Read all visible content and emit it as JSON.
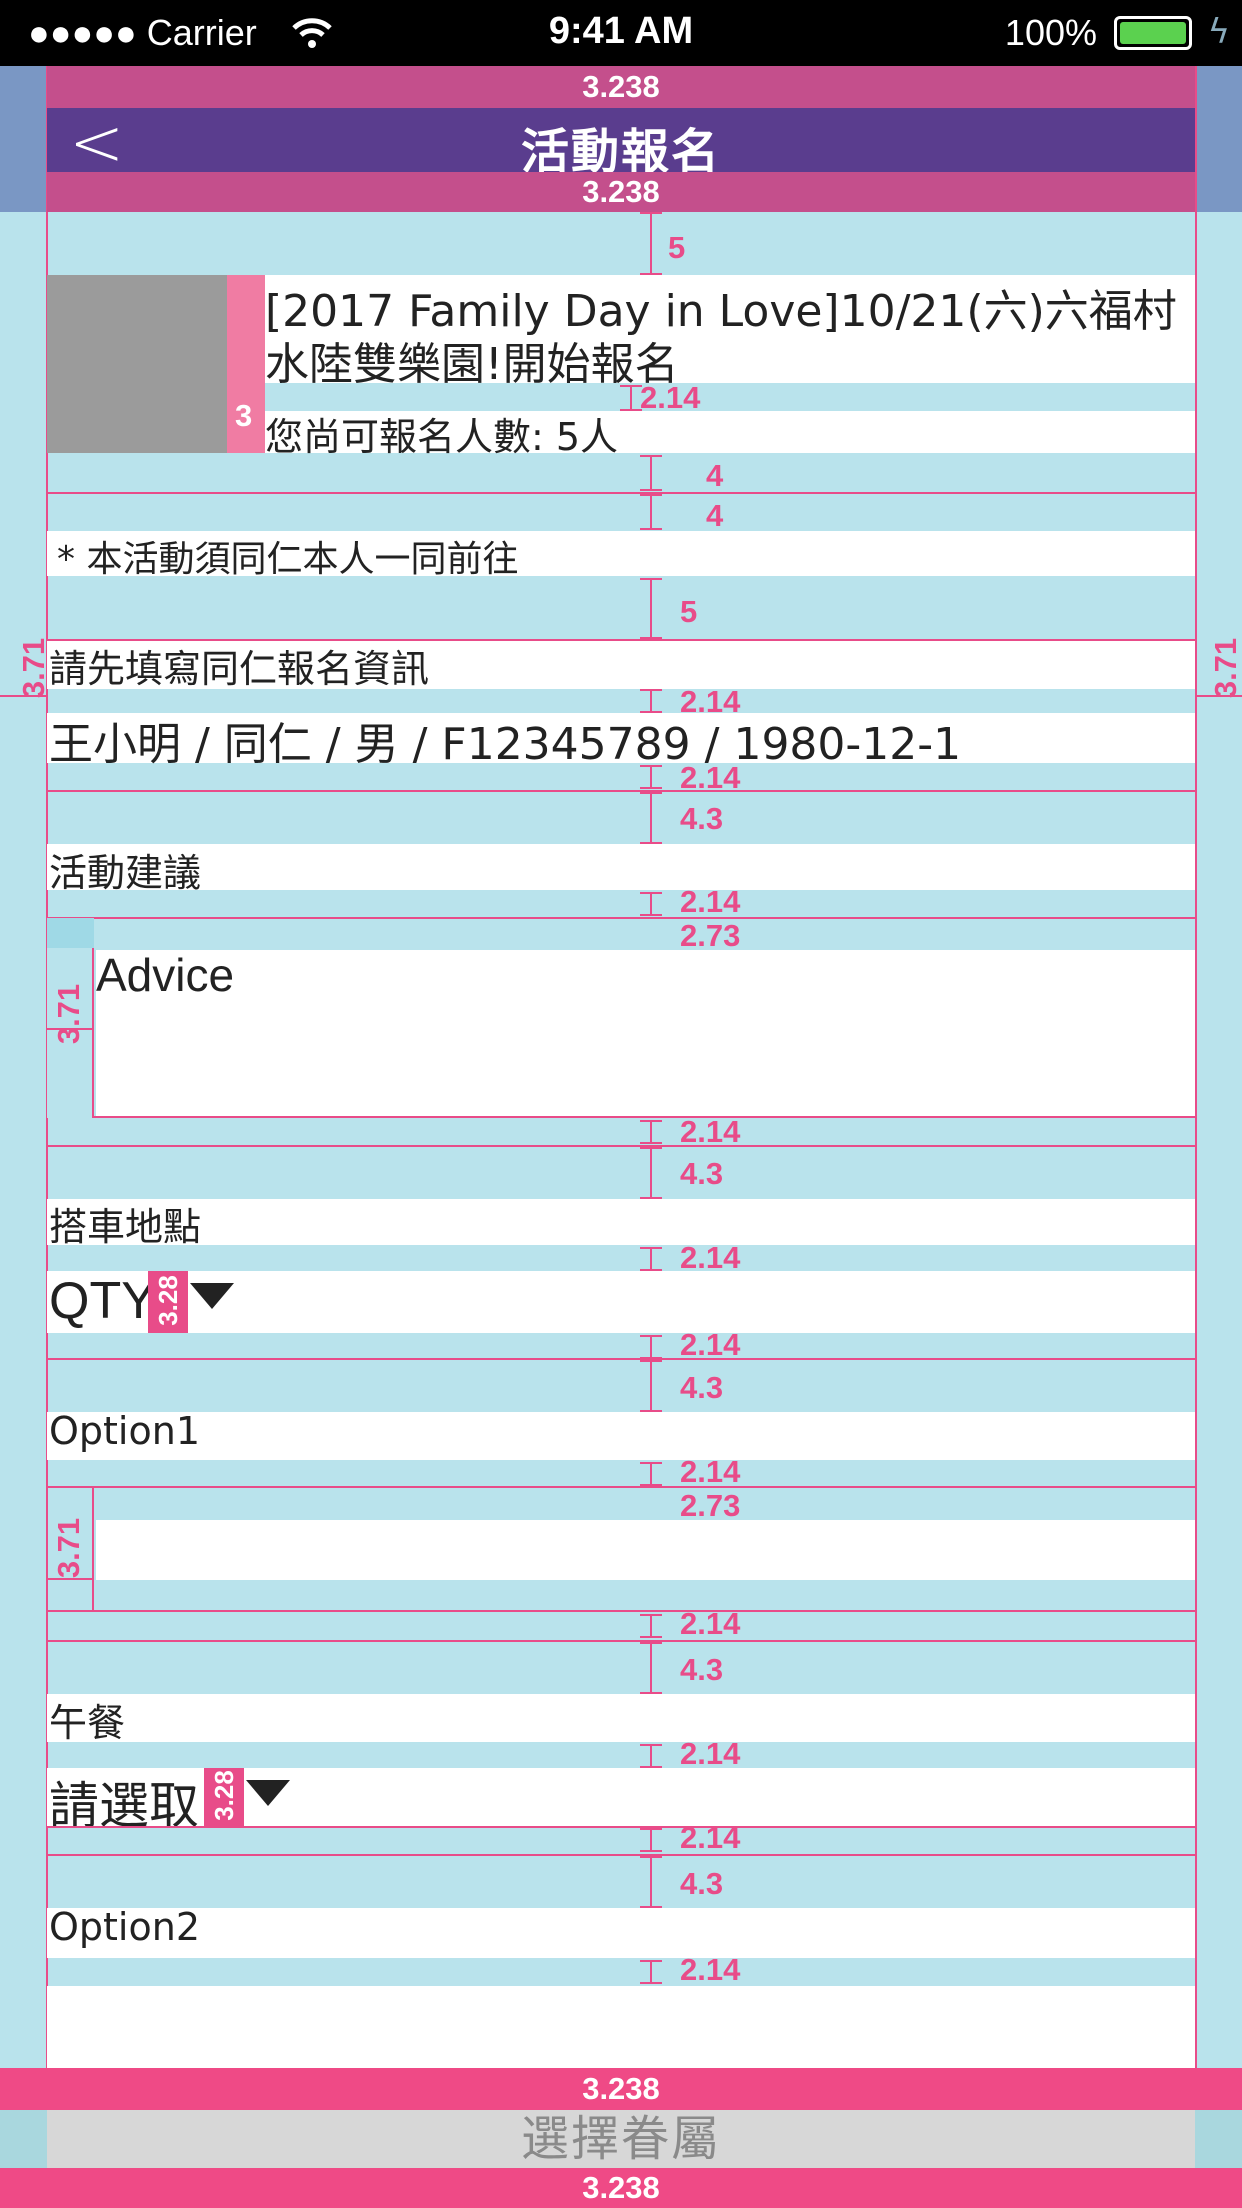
{
  "status_bar": {
    "carrier": "●●●●● Carrier",
    "time": "9:41 AM",
    "battery_pct": "100%"
  },
  "nav": {
    "title": "活動報名",
    "back_icon": "chevron-left-icon"
  },
  "event": {
    "title_line1": "[2017 Family Day in Love]10/21(六)六福村",
    "title_line2": "水陸雙樂園!開始報名",
    "remaining": "您尚可報名人數: 5人"
  },
  "notice": "* 本活動須同仁本人一同前往",
  "applicant": {
    "heading": "請先填寫同仁報名資訊",
    "info": "王小明 / 同仁 / 男 / F12345789 / 1980-12-1"
  },
  "advice": {
    "label": "活動建議",
    "placeholder": "Advice"
  },
  "pickup": {
    "label": "搭車地點",
    "value": "QTY"
  },
  "option1": {
    "label": "Option1"
  },
  "lunch": {
    "label": "午餐",
    "value": "請選取"
  },
  "option2": {
    "label": "Option2"
  },
  "footer": {
    "select_family_label": "選擇眷屬"
  },
  "dims": {
    "d3238": "3.238",
    "d5": "5",
    "d214": "2.14",
    "d4": "4",
    "d3": "3",
    "d43": "4.3",
    "d273": "2.73",
    "d371": "3.71",
    "d328": "3.28"
  },
  "colors": {
    "nav_bg": "#5a3d8e",
    "guide_pink": "#e84c89",
    "margin_blue": "#b9e3ec",
    "footer_button_bg": "#d7d7d7"
  }
}
